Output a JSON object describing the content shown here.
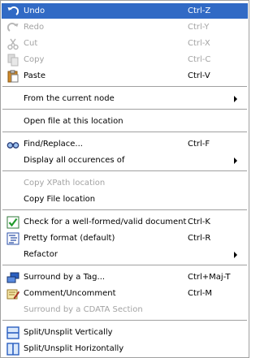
{
  "items": [
    {
      "label": "Undo",
      "shortcut": "Ctrl-Z",
      "icon": "undo-icon"
    },
    {
      "label": "Redo",
      "shortcut": "Ctrl-Y",
      "icon": "redo-icon"
    },
    {
      "label": "Cut",
      "shortcut": "Ctrl-X",
      "icon": "cut-icon"
    },
    {
      "label": "Copy",
      "shortcut": "Ctrl-C",
      "icon": "copy-icon"
    },
    {
      "label": "Paste",
      "shortcut": "Ctrl-V",
      "icon": "paste-icon"
    },
    {
      "label": "From the current node",
      "submenu": true
    },
    {
      "label": "Open file at this location"
    },
    {
      "label": "Find/Replace...",
      "shortcut": "Ctrl-F",
      "icon": "find-replace-icon"
    },
    {
      "label": "Display all occurences of",
      "submenu": true
    },
    {
      "label": "Copy XPath location"
    },
    {
      "label": "Copy File location"
    },
    {
      "label": "Check for a well-formed/valid document",
      "shortcut": "Ctrl-K",
      "icon": "validate-check-icon"
    },
    {
      "label": "Pretty format (default)",
      "shortcut": "Ctrl-R",
      "icon": "pretty-format-icon"
    },
    {
      "label": "Refactor",
      "submenu": true
    },
    {
      "label": "Surround by a Tag...",
      "shortcut": "Ctrl+Maj-T",
      "icon": "surround-tag-icon"
    },
    {
      "label": "Comment/Uncomment",
      "shortcut": "Ctrl-M",
      "icon": "comment-icon"
    },
    {
      "label": "Surround by a CDATA Section"
    },
    {
      "label": "Split/Unsplit Vertically",
      "icon": "split-vertical-icon"
    },
    {
      "label": "Split/Unsplit Horizontally",
      "icon": "split-horizontal-icon"
    }
  ],
  "colors": {
    "highlight": "#316ac5",
    "disabled_text": "#a3a3a3",
    "separator": "#a0a0a0"
  }
}
